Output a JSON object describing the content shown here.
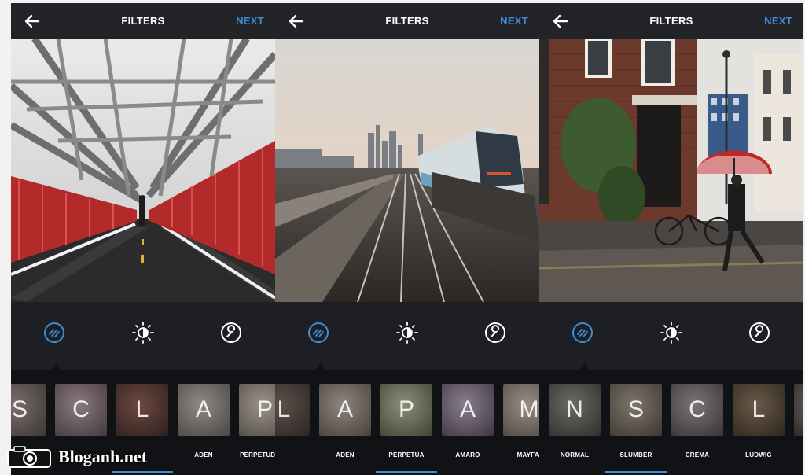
{
  "colors": {
    "accent": "#3b8ed6",
    "topbar": "#222327",
    "tools_bg": "#1e1f24",
    "strip_bg": "#111216"
  },
  "panels": [
    {
      "title": "FILTERS",
      "next_label": "NEXT",
      "photo": "bridge",
      "thumbs": [
        {
          "letter": "S",
          "label": ""
        },
        {
          "letter": "C",
          "label": ""
        },
        {
          "letter": "L",
          "label": ""
        },
        {
          "letter": "A",
          "label": "ADEN"
        },
        {
          "letter": "P",
          "label": "PERPETUDWIG"
        }
      ]
    },
    {
      "title": "FILTERS",
      "next_label": "NEXT",
      "photo": "train",
      "thumbs": [
        {
          "letter": "L",
          "label": ""
        },
        {
          "letter": "A",
          "label": "ADEN"
        },
        {
          "letter": "P",
          "label": "PERPETUA"
        },
        {
          "letter": "A",
          "label": "AMARO"
        },
        {
          "letter": "M",
          "label": "MAYFAI"
        }
      ]
    },
    {
      "title": "FILTERS",
      "next_label": "NEXT",
      "photo": "street",
      "thumbs": [
        {
          "letter": "N",
          "label": "NORMAL"
        },
        {
          "letter": "S",
          "label": "SLUMBER"
        },
        {
          "letter": "C",
          "label": "CREMA"
        },
        {
          "letter": "L",
          "label": "LUDWIG"
        },
        {
          "letter": "",
          "label": ""
        }
      ]
    }
  ],
  "tools": {
    "filter": "filter-icon",
    "lux": "lux-icon",
    "edit": "wrench-icon"
  },
  "watermark": {
    "text": "Bloganh.net"
  }
}
